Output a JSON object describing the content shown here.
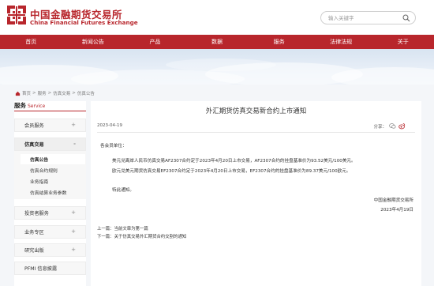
{
  "header": {
    "logo_cn": "中国金融期货交易所",
    "logo_en": "China Financial Futures Exchange",
    "search_placeholder": "输入关键字"
  },
  "nav": [
    "首页",
    "新闻公告",
    "产品",
    "数据",
    "服务",
    "法律法规",
    "关于"
  ],
  "breadcrumb": [
    "首页",
    "服务",
    "仿真交易",
    "仿真公告"
  ],
  "breadcrumb_sep": ">",
  "sidebar": {
    "title_cn": "服务",
    "title_en": "Service",
    "items": [
      {
        "label": "会员服务",
        "arrow": "+"
      },
      {
        "label": "仿真交易",
        "arrow": "-"
      },
      {
        "label": "投资者服务",
        "arrow": "+"
      },
      {
        "label": "业务专区",
        "arrow": "+"
      },
      {
        "label": "研究出版",
        "arrow": "+"
      },
      {
        "label": "PFMI 信息披露",
        "arrow": ""
      }
    ],
    "subitems": [
      "仿真公告",
      "仿真合约规则",
      "业务指南",
      "仿真结算业务参数"
    ]
  },
  "article": {
    "title": "外汇期货仿真交易新合约上市通知",
    "date": "2023-04-19",
    "share_label": "分享：",
    "salutation": "各会员单位：",
    "paragraph1": "美元兑离岸人民币仿真交易AF2307合约定于2023年4月20日上市交易，AF2307合约的挂盘基准价为93.52美元/100美元。",
    "paragraph2": "欧元兑美元期货仿真交易EF2307合约定于2023年4月20日上市交易，EF2307合约的挂盘基准价为89.37美元/100欧元。",
    "closing": "特此通知。",
    "sign_org": "中国金融期货交易所",
    "sign_date": "2023年4月19日",
    "prev_label": "上一篇：",
    "prev_title": "当前文章为第一篇",
    "next_label": "下一篇：",
    "next_title": "关于仿真交易外汇期货合约交割的通知"
  },
  "colors": {
    "brand": "#b8262c",
    "banner": "#dce6f2"
  }
}
